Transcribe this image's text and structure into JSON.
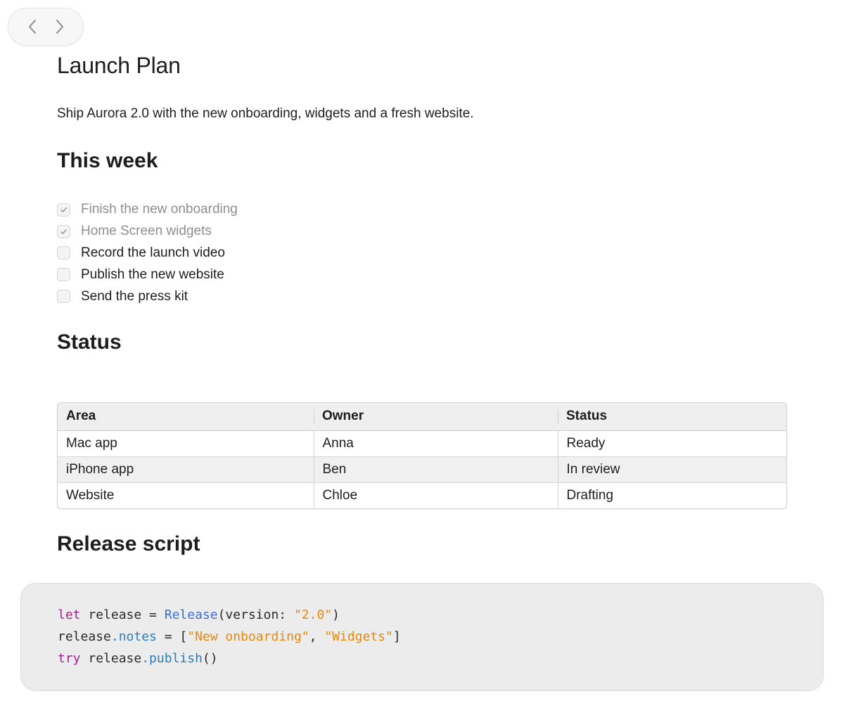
{
  "document": {
    "title": "Launch Plan",
    "description": "Ship Aurora 2.0 with the new onboarding, widgets and a fresh website."
  },
  "sections": {
    "this_week": "This week",
    "status": "Status",
    "release_script": "Release script"
  },
  "checklist": [
    {
      "label": "Finish the new onboarding",
      "checked": true
    },
    {
      "label": "Home Screen widgets",
      "checked": true
    },
    {
      "label": "Record the launch video",
      "checked": false
    },
    {
      "label": "Publish the new website",
      "checked": false
    },
    {
      "label": "Send the press kit",
      "checked": false
    }
  ],
  "status_table": {
    "headers": [
      "Area",
      "Owner",
      "Status"
    ],
    "rows": [
      [
        "Mac app",
        "Anna",
        "Ready"
      ],
      [
        "iPhone app",
        "Ben",
        "In review"
      ],
      [
        "Website",
        "Chloe",
        "Drafting"
      ]
    ]
  },
  "code": {
    "lines": [
      [
        [
          "kw",
          "let"
        ],
        [
          "",
          "  release = "
        ],
        [
          "ty",
          "Release"
        ],
        [
          "",
          "(version: "
        ],
        [
          "st",
          "\"2.0\""
        ],
        [
          "",
          ")"
        ]
      ],
      [
        [
          "",
          "release"
        ],
        [
          "pr",
          ".notes"
        ],
        [
          "",
          " = ["
        ],
        [
          "st",
          "\"New onboarding\""
        ],
        [
          "",
          ", "
        ],
        [
          "st",
          "\"Widgets\""
        ],
        [
          "",
          "]"
        ]
      ],
      [
        [
          "kw",
          "try"
        ],
        [
          "",
          " release"
        ],
        [
          "pr",
          ".publish"
        ],
        [
          "",
          "()"
        ]
      ]
    ]
  },
  "icons": {
    "back": "chevron-left-icon",
    "forward": "chevron-right-icon",
    "check": "checkmark-icon"
  },
  "colors": {
    "keyword": "#9b2393",
    "type": "#3d6fd6",
    "string": "#e8890c",
    "property": "#2a7fb8"
  }
}
